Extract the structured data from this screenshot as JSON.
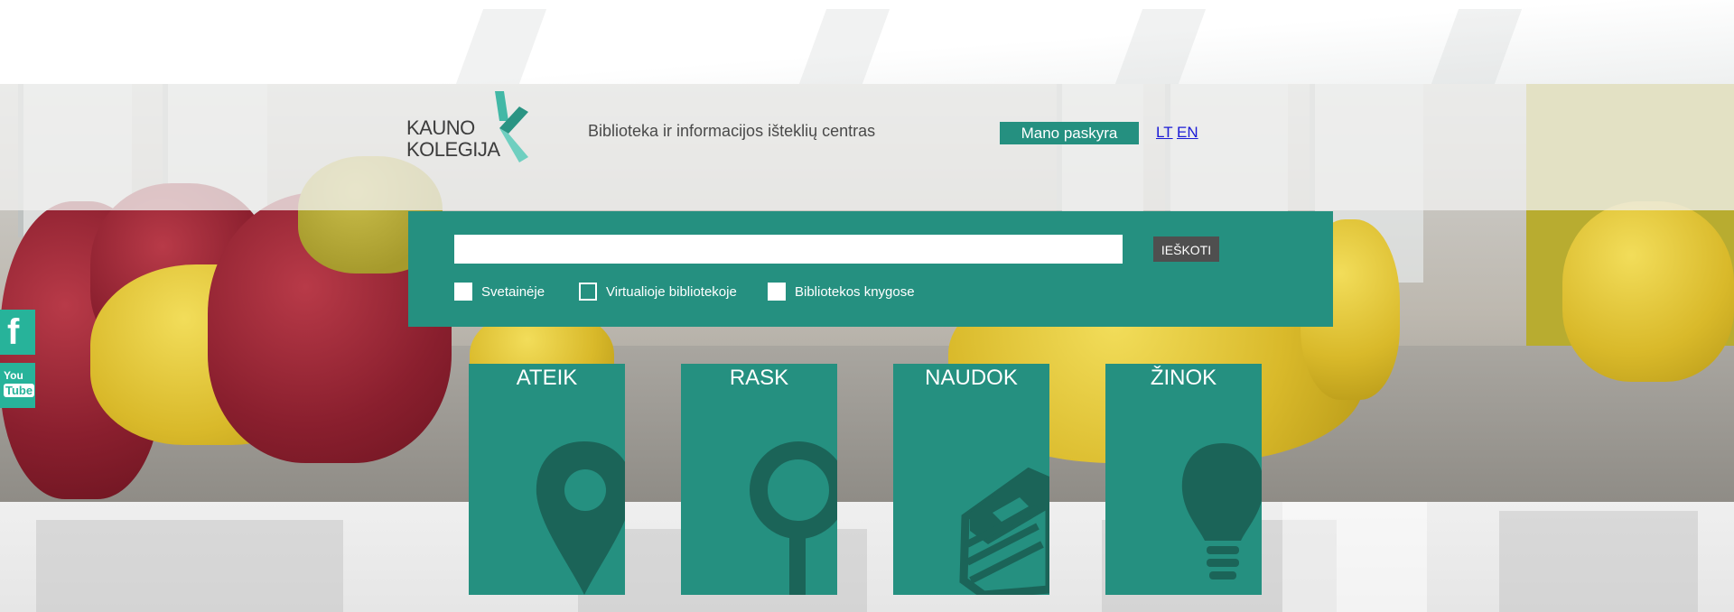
{
  "header": {
    "logo_line1": "KAUNO",
    "logo_line2": "KOLEGIJA",
    "subtitle": "Biblioteka ir informacijos išteklių centras",
    "account_label": "Mano paskyra",
    "languages": [
      "LT",
      "EN"
    ]
  },
  "search": {
    "input_value": "",
    "button_label": "IEŠKOTI",
    "options": [
      {
        "label": "Svetainėje",
        "checked": false
      },
      {
        "label": "Virtualioje bibliotekoje",
        "checked": false
      },
      {
        "label": "Bibliotekos knygose",
        "checked": false
      }
    ]
  },
  "social": [
    {
      "icon": "facebook-icon",
      "text": "f"
    },
    {
      "icon": "youtube-icon",
      "text_top": "You",
      "text_bottom": "Tube"
    }
  ],
  "tiles": [
    {
      "title": "ATEIK",
      "icon": "location-pin-icon"
    },
    {
      "title": "RASK",
      "icon": "magnifier-icon"
    },
    {
      "title": "NAUDOK",
      "icon": "books-icon"
    },
    {
      "title": "ŽINOK",
      "icon": "lightbulb-icon"
    }
  ],
  "colors": {
    "brand_green": "#259080",
    "icon_dark_green": "#1b6458",
    "social_green": "#27b39a",
    "search_button": "#4f4f4f",
    "link_blue": "#1a1ad6"
  }
}
